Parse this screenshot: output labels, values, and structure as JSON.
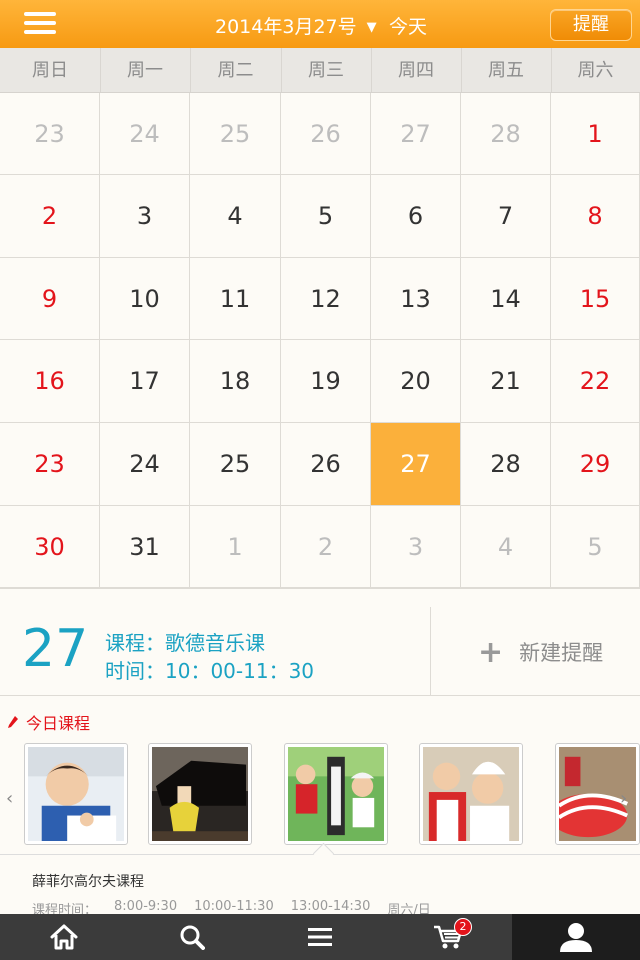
{
  "header": {
    "date_title": "2014年3月27号",
    "caret": "▼",
    "today_label": "今天",
    "remind_label": "提醒"
  },
  "weekdays": [
    "周日",
    "周一",
    "周二",
    "周三",
    "周四",
    "周五",
    "周六"
  ],
  "calendar": {
    "weeks": [
      [
        {
          "d": "23",
          "other": true
        },
        {
          "d": "24",
          "other": true
        },
        {
          "d": "25",
          "other": true
        },
        {
          "d": "26",
          "other": true
        },
        {
          "d": "27",
          "other": true
        },
        {
          "d": "28",
          "other": true
        },
        {
          "d": "1",
          "other": false
        }
      ],
      [
        {
          "d": "2",
          "other": false
        },
        {
          "d": "3",
          "other": false
        },
        {
          "d": "4",
          "other": false
        },
        {
          "d": "5",
          "other": false
        },
        {
          "d": "6",
          "other": false
        },
        {
          "d": "7",
          "other": false
        },
        {
          "d": "8",
          "other": false
        }
      ],
      [
        {
          "d": "9",
          "other": false
        },
        {
          "d": "10",
          "other": false
        },
        {
          "d": "11",
          "other": false
        },
        {
          "d": "12",
          "other": false
        },
        {
          "d": "13",
          "other": false
        },
        {
          "d": "14",
          "other": false
        },
        {
          "d": "15",
          "other": false
        }
      ],
      [
        {
          "d": "16",
          "other": false
        },
        {
          "d": "17",
          "other": false
        },
        {
          "d": "18",
          "other": false
        },
        {
          "d": "19",
          "other": false
        },
        {
          "d": "20",
          "other": false
        },
        {
          "d": "21",
          "other": false
        },
        {
          "d": "22",
          "other": false
        }
      ],
      [
        {
          "d": "23",
          "other": false
        },
        {
          "d": "24",
          "other": false
        },
        {
          "d": "25",
          "other": false
        },
        {
          "d": "26",
          "other": false
        },
        {
          "d": "27",
          "other": false,
          "today": true
        },
        {
          "d": "28",
          "other": false
        },
        {
          "d": "29",
          "other": false
        }
      ],
      [
        {
          "d": "30",
          "other": false
        },
        {
          "d": "31",
          "other": false
        },
        {
          "d": "1",
          "other": true
        },
        {
          "d": "2",
          "other": true
        },
        {
          "d": "3",
          "other": true
        },
        {
          "d": "4",
          "other": true
        },
        {
          "d": "5",
          "other": true
        }
      ]
    ]
  },
  "info": {
    "day": "27",
    "course": "课程：歌德音乐课",
    "time": "时间：10：00-11：30",
    "new_remind": "新建提醒",
    "plus": "+"
  },
  "today_course": {
    "label": "今日课程",
    "left_arrow": "‹",
    "right_arrow": "›",
    "thumbs": [
      "child-writing",
      "piano-recital",
      "golf-kids",
      "cooking-kids",
      "play-tunnel"
    ],
    "detail_name": "薛菲尔高尔夫课程",
    "detail_label": "课程时间：",
    "slots": [
      "8:00-9:30",
      "10:00-11:30",
      "13:00-14:30",
      "周六/日"
    ]
  },
  "nav": {
    "items": [
      "home-icon",
      "search-icon",
      "menu-icon",
      "cart-icon",
      "user-icon"
    ],
    "cart_badge": "2"
  }
}
